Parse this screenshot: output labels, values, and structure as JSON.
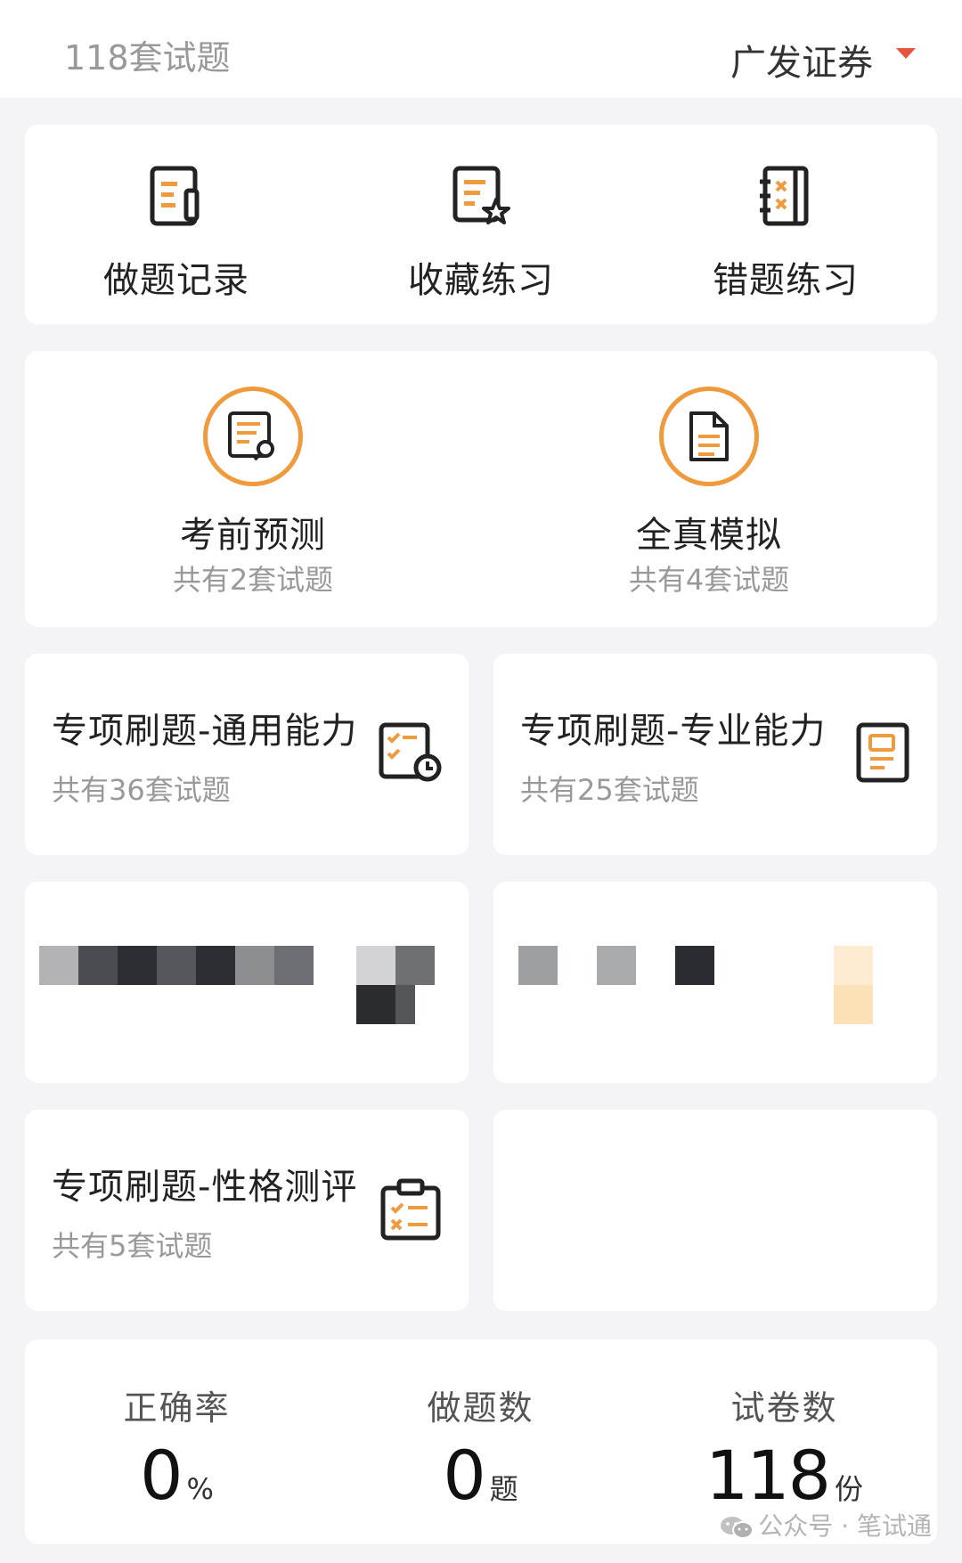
{
  "header": {
    "count_text": "118套试题",
    "company": "广发证券"
  },
  "quick_actions": [
    {
      "label": "做题记录",
      "icon": "doc-pencil-icon"
    },
    {
      "label": "收藏练习",
      "icon": "doc-star-icon"
    },
    {
      "label": "错题练习",
      "icon": "notebook-x-icon"
    }
  ],
  "tests": [
    {
      "title": "考前预测",
      "subtitle": "共有2套试题",
      "icon": "doc-search-icon"
    },
    {
      "title": "全真模拟",
      "subtitle": "共有4套试题",
      "icon": "document-icon"
    }
  ],
  "special": [
    {
      "title": "专项刷题-通用能力",
      "subtitle": "共有36套试题",
      "icon": "checklist-clock-icon"
    },
    {
      "title": "专项刷题-专业能力",
      "subtitle": "共有25套试题",
      "icon": "profile-doc-icon"
    },
    {
      "title": "专项刷题-性格测评",
      "subtitle": "共有5套试题",
      "icon": "clipboard-check-icon"
    }
  ],
  "stats": [
    {
      "label": "正确率",
      "value": "0",
      "unit": "%"
    },
    {
      "label": "做题数",
      "value": "0",
      "unit": "题"
    },
    {
      "label": "试卷数",
      "value": "118",
      "unit": "份"
    }
  ],
  "watermark": "公众号 · 笔试通",
  "colors": {
    "accent": "#ee9a3d",
    "caret": "#e4563b"
  }
}
